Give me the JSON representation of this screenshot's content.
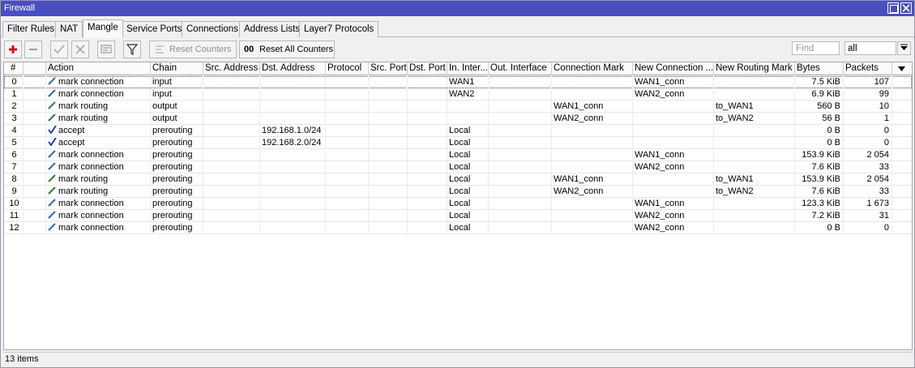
{
  "window": {
    "title": "Firewall"
  },
  "tabs": [
    {
      "label": "Filter Rules"
    },
    {
      "label": "NAT"
    },
    {
      "label": "Mangle",
      "active": true
    },
    {
      "label": "Service Ports"
    },
    {
      "label": "Connections"
    },
    {
      "label": "Address Lists"
    },
    {
      "label": "Layer7 Protocols"
    }
  ],
  "toolbar": {
    "reset_counters": "Reset Counters",
    "reset_all_counters": "Reset All Counters",
    "reset_all_prefix": "00",
    "find_placeholder": "Find",
    "filter_value": "all"
  },
  "columns": [
    "#",
    "",
    "Action",
    "Chain",
    "Src. Address",
    "Dst. Address",
    "Protocol",
    "Src. Port",
    "Dst. Port",
    "In. Inter...",
    "Out. Interface",
    "Connection Mark",
    "New Connection ...",
    "New Routing Mark",
    "Bytes",
    "Packets"
  ],
  "rows": [
    {
      "num": "0",
      "action": "mark connection",
      "icon": "mark-connection-icon",
      "chain": "input",
      "dst": "",
      "in_if": "WAN1",
      "conn_mark": "",
      "new_conn_mark": "WAN1_conn",
      "new_routing_mark": "",
      "bytes": "7.5 KiB",
      "packets": "107"
    },
    {
      "num": "1",
      "action": "mark connection",
      "icon": "mark-connection-icon",
      "chain": "input",
      "dst": "",
      "in_if": "WAN2",
      "conn_mark": "",
      "new_conn_mark": "WAN2_conn",
      "new_routing_mark": "",
      "bytes": "6.9 KiB",
      "packets": "99"
    },
    {
      "num": "2",
      "action": "mark routing",
      "icon": "mark-routing-icon",
      "chain": "output",
      "dst": "",
      "in_if": "",
      "conn_mark": "WAN1_conn",
      "new_conn_mark": "",
      "new_routing_mark": "to_WAN1",
      "bytes": "560 B",
      "packets": "10"
    },
    {
      "num": "3",
      "action": "mark routing",
      "icon": "mark-routing-icon",
      "chain": "output",
      "dst": "",
      "in_if": "",
      "conn_mark": "WAN2_conn",
      "new_conn_mark": "",
      "new_routing_mark": "to_WAN2",
      "bytes": "56 B",
      "packets": "1"
    },
    {
      "num": "4",
      "action": "accept",
      "icon": "accept-check-icon",
      "chain": "prerouting",
      "dst": "192.168.1.0/24",
      "in_if": "Local",
      "conn_mark": "",
      "new_conn_mark": "",
      "new_routing_mark": "",
      "bytes": "0 B",
      "packets": "0"
    },
    {
      "num": "5",
      "action": "accept",
      "icon": "accept-check-icon",
      "chain": "prerouting",
      "dst": "192.168.2.0/24",
      "in_if": "Local",
      "conn_mark": "",
      "new_conn_mark": "",
      "new_routing_mark": "",
      "bytes": "0 B",
      "packets": "0"
    },
    {
      "num": "6",
      "action": "mark connection",
      "icon": "mark-connection-icon",
      "chain": "prerouting",
      "dst": "",
      "in_if": "Local",
      "conn_mark": "",
      "new_conn_mark": "WAN1_conn",
      "new_routing_mark": "",
      "bytes": "153.9 KiB",
      "packets": "2 054"
    },
    {
      "num": "7",
      "action": "mark connection",
      "icon": "mark-connection-icon",
      "chain": "prerouting",
      "dst": "",
      "in_if": "Local",
      "conn_mark": "",
      "new_conn_mark": "WAN2_conn",
      "new_routing_mark": "",
      "bytes": "7.6 KiB",
      "packets": "33"
    },
    {
      "num": "8",
      "action": "mark routing",
      "icon": "mark-routing-icon",
      "chain": "prerouting",
      "dst": "",
      "in_if": "Local",
      "conn_mark": "WAN1_conn",
      "new_conn_mark": "",
      "new_routing_mark": "to_WAN1",
      "bytes": "153.9 KiB",
      "packets": "2 054"
    },
    {
      "num": "9",
      "action": "mark routing",
      "icon": "mark-routing-icon",
      "chain": "prerouting",
      "dst": "",
      "in_if": "Local",
      "conn_mark": "WAN2_conn",
      "new_conn_mark": "",
      "new_routing_mark": "to_WAN2",
      "bytes": "7.6 KiB",
      "packets": "33"
    },
    {
      "num": "10",
      "action": "mark connection",
      "icon": "mark-connection-icon",
      "chain": "prerouting",
      "dst": "",
      "in_if": "Local",
      "conn_mark": "",
      "new_conn_mark": "WAN1_conn",
      "new_routing_mark": "",
      "bytes": "123.3 KiB",
      "packets": "1 673"
    },
    {
      "num": "11",
      "action": "mark connection",
      "icon": "mark-connection-icon",
      "chain": "prerouting",
      "dst": "",
      "in_if": "Local",
      "conn_mark": "",
      "new_conn_mark": "WAN2_conn",
      "new_routing_mark": "",
      "bytes": "7.2 KiB",
      "packets": "31"
    },
    {
      "num": "12",
      "action": "mark connection",
      "icon": "mark-connection-icon",
      "chain": "prerouting",
      "dst": "",
      "in_if": "Local",
      "conn_mark": "",
      "new_conn_mark": "WAN2_conn",
      "new_routing_mark": "",
      "bytes": "0 B",
      "packets": "0"
    }
  ],
  "status": {
    "items_count": "13 items"
  },
  "colors": {
    "titlebar": "#4a4fbf",
    "add_red": "#d0141b",
    "accept_blue": "#1a2fb3",
    "mark_green": "#2f7d3a"
  }
}
